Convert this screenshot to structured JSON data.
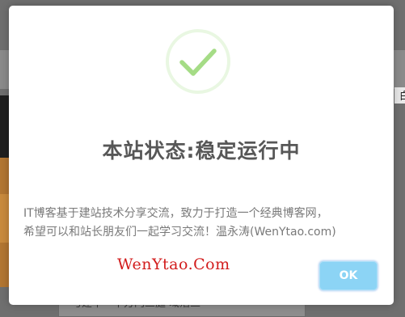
{
  "dialog": {
    "icon": "success-check-icon",
    "title": "本站状态:稳定运行中",
    "message_line1": "IT博客基于建站技术分享交流，致力于打造一个经典博客网，",
    "message_line2": "希望可以和站长朋友们一起学习交流！温永涛(WenYtao.com)",
    "watermark": "WenYtao.Com",
    "ok_label": "OK"
  },
  "background": {
    "right_char": "白",
    "bottom_text": "与建平一平方门三庭 域活三"
  },
  "colors": {
    "check": "#a5dc86",
    "check_ring": "#e9f7e2",
    "button": "#8cd4f5",
    "watermark": "#d21c1c",
    "title": "#575757",
    "message": "#797979"
  }
}
